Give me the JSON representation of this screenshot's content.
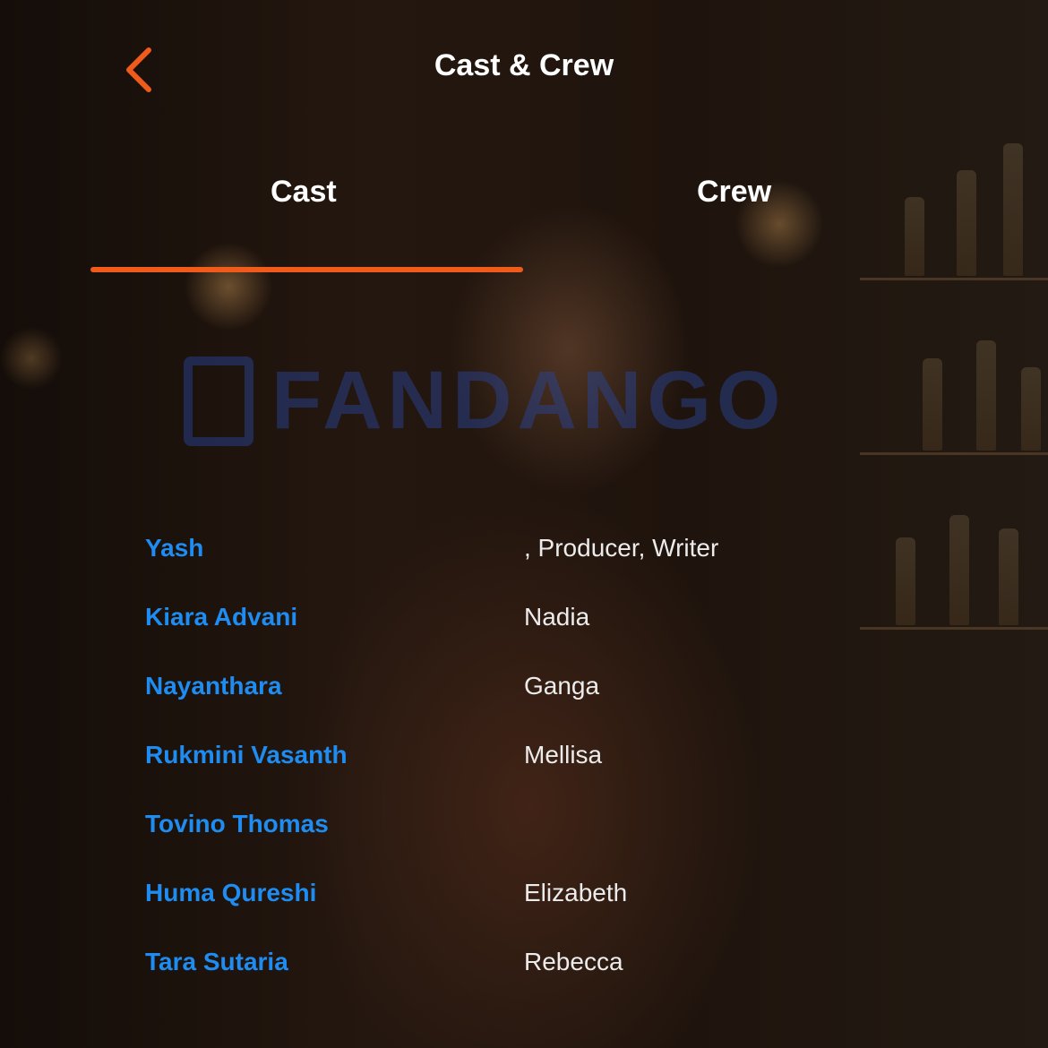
{
  "header": {
    "title": "Cast & Crew",
    "back_icon": "chevron-left-icon"
  },
  "tabs": [
    {
      "label": "Cast",
      "selected": true
    },
    {
      "label": "Crew",
      "selected": false
    }
  ],
  "accent_color": "#f05a1a",
  "link_color": "#1e8cf0",
  "watermark": "FANDANGO",
  "cast": [
    {
      "name": "Yash",
      "role": ", Producer, Writer"
    },
    {
      "name": "Kiara Advani",
      "role": "Nadia"
    },
    {
      "name": "Nayanthara",
      "role": "Ganga"
    },
    {
      "name": "Rukmini Vasanth",
      "role": "Mellisa"
    },
    {
      "name": "Tovino Thomas",
      "role": ""
    },
    {
      "name": "Huma Qureshi",
      "role": "Elizabeth"
    },
    {
      "name": "Tara Sutaria",
      "role": "Rebecca"
    }
  ]
}
